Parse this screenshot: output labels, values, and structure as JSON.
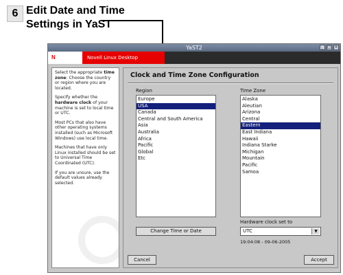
{
  "callout": {
    "step_number": "6",
    "title_line1": "Edit Date and Time",
    "title_line2": "Settings in YaST"
  },
  "window": {
    "title": "YaST2",
    "banner_logo": "N",
    "banner_text": "Novell Linux Desktop"
  },
  "help": {
    "p1_pre": "Select the appropriate ",
    "p1_bold": "time zone",
    "p1_post": ": Choose the country or region where you are located.",
    "p2_pre": "Specify whether the ",
    "p2_bold": "hardware clock",
    "p2_post": " of your machine is set to local time or UTC.",
    "p3": "Most PCs that also have other operating systems installed (such as Microsoft Windows) use local time.",
    "p4": "Machines that have only Linux installed should be set to Universal Time Coordinated (UTC).",
    "p5": "If you are unsure, use the default values already selected."
  },
  "main": {
    "title": "Clock and Time Zone Configuration",
    "region_label": "Region",
    "timezone_label": "Time Zone",
    "regions": [
      "Europe",
      "USA",
      "Canada",
      "Central and South America",
      "Asia",
      "Australia",
      "Africa",
      "Pacific",
      "Global",
      "Etc"
    ],
    "selected_region": "USA",
    "timezones": [
      "Alaska",
      "Aleutian",
      "Arizona",
      "Central",
      "Eastern",
      "East Indiana",
      "Hawaii",
      "Indiana Starke",
      "Michigan",
      "Mountain",
      "Pacific",
      "Samoa"
    ],
    "selected_timezone": "Eastern",
    "change_button": "Change Time or Date",
    "hw_clock_label": "Hardware clock set to",
    "hw_clock_value": "UTC",
    "datetime": "19:04:08 - 09-06-2005",
    "cancel_button": "Cancel",
    "accept_button": "Accept"
  },
  "colors": {
    "selection": "#13207c",
    "banner_red": "#e60000"
  }
}
